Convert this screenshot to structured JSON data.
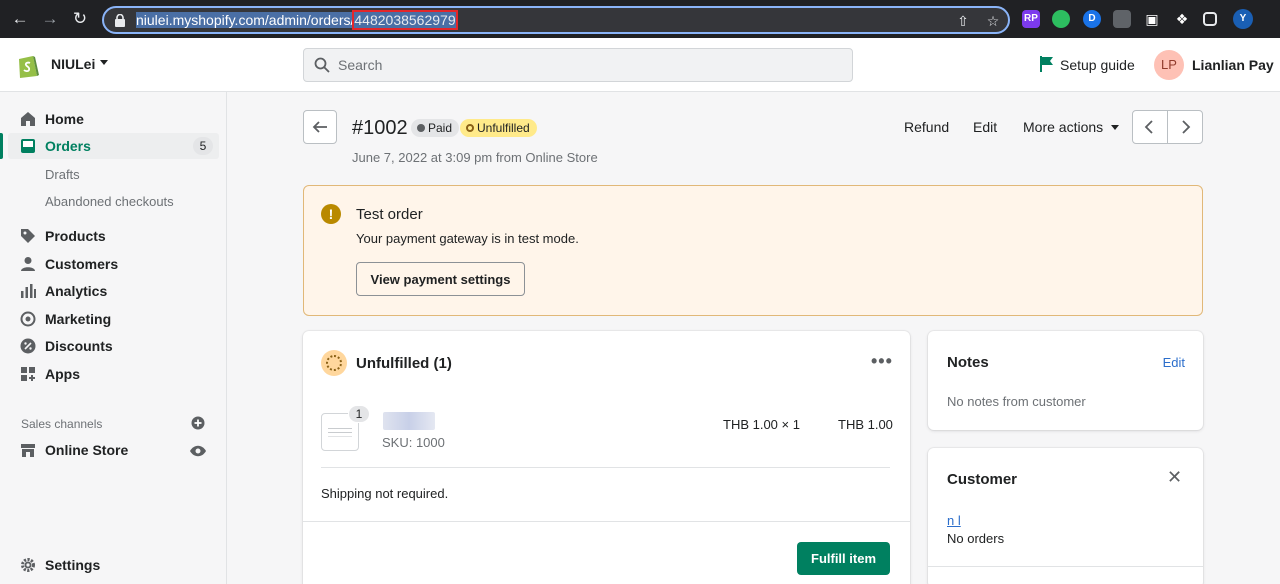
{
  "browser": {
    "url_main": "niulei.myshopify.com/admin/orders/",
    "url_id": "4482038562979",
    "extensions": [
      {
        "label": "RP",
        "color": "#7c3aed"
      },
      {
        "label": "",
        "color": "#2dbe60"
      },
      {
        "label": "D",
        "color": "#1a73e8"
      }
    ],
    "profile_initial": "Y"
  },
  "topbar": {
    "store_name": "NIULei",
    "search_placeholder": "Search",
    "setup_guide": "Setup guide",
    "avatar_initials": "LP",
    "user_name": "Lianlian Pay"
  },
  "sidebar": {
    "home": "Home",
    "orders": "Orders",
    "orders_count": "5",
    "drafts": "Drafts",
    "abandoned": "Abandoned checkouts",
    "products": "Products",
    "customers": "Customers",
    "analytics": "Analytics",
    "marketing": "Marketing",
    "discounts": "Discounts",
    "apps": "Apps",
    "sales_channels": "Sales channels",
    "online_store": "Online Store",
    "settings": "Settings"
  },
  "order": {
    "number": "#1002",
    "paid_badge": "Paid",
    "fulfillment_badge": "Unfulfilled",
    "date_line": "June 7, 2022 at 3:09 pm from Online Store",
    "refund": "Refund",
    "edit": "Edit",
    "more_actions": "More actions"
  },
  "banner": {
    "title": "Test order",
    "text": "Your payment gateway is in test mode.",
    "button": "View payment settings"
  },
  "fulfillment": {
    "title": "Unfulfilled (1)",
    "item_qty": "1",
    "sku": "SKU: 1000",
    "unit_price": "THB 1.00 × 1",
    "total": "THB 1.00",
    "shipping_note": "Shipping not required.",
    "fulfill_button": "Fulfill item"
  },
  "notes": {
    "title": "Notes",
    "edit": "Edit",
    "text": "No notes from customer"
  },
  "customer": {
    "title": "Customer",
    "name": "n l",
    "orders": "No orders"
  },
  "colors": {
    "brand_green": "#008060",
    "link_blue": "#2c6ecb",
    "warning_bg": "#fff5ea",
    "unfulfilled_badge": "#ffea8a"
  }
}
